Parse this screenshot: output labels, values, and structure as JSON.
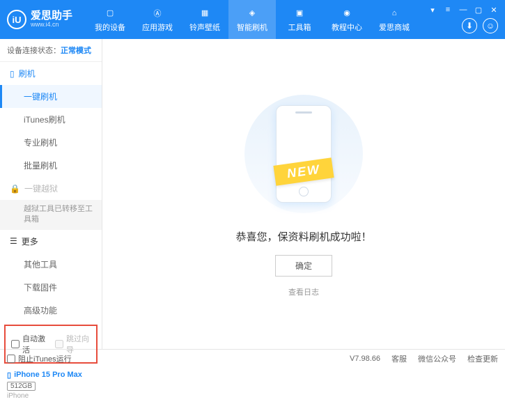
{
  "logo": {
    "badge": "iU",
    "title": "爱思助手",
    "url": "www.i4.cn"
  },
  "nav": [
    {
      "label": "我的设备"
    },
    {
      "label": "应用游戏"
    },
    {
      "label": "铃声壁纸"
    },
    {
      "label": "智能刷机"
    },
    {
      "label": "工具箱"
    },
    {
      "label": "教程中心"
    },
    {
      "label": "爱思商城"
    }
  ],
  "status": {
    "prefix": "设备连接状态：",
    "mode": "正常模式"
  },
  "sidebar": {
    "flash_header": "刷机",
    "items": [
      "一键刷机",
      "iTunes刷机",
      "专业刷机",
      "批量刷机"
    ],
    "jailbreak": "一键越狱",
    "jailbreak_note": "越狱工具已转移至工具箱",
    "more_header": "更多",
    "more_items": [
      "其他工具",
      "下载固件",
      "高级功能"
    ]
  },
  "checkboxes": {
    "auto_activate": "自动激活",
    "skip_guide": "跳过向导"
  },
  "device": {
    "name": "iPhone 15 Pro Max",
    "storage": "512GB",
    "model": "iPhone"
  },
  "main": {
    "new_badge": "NEW",
    "success_msg": "恭喜您，保资料刷机成功啦！",
    "ok_button": "确定",
    "view_log": "查看日志"
  },
  "footer": {
    "block_itunes": "阻止iTunes运行",
    "version": "V7.98.66",
    "links": [
      "客服",
      "微信公众号",
      "检查更新"
    ]
  }
}
